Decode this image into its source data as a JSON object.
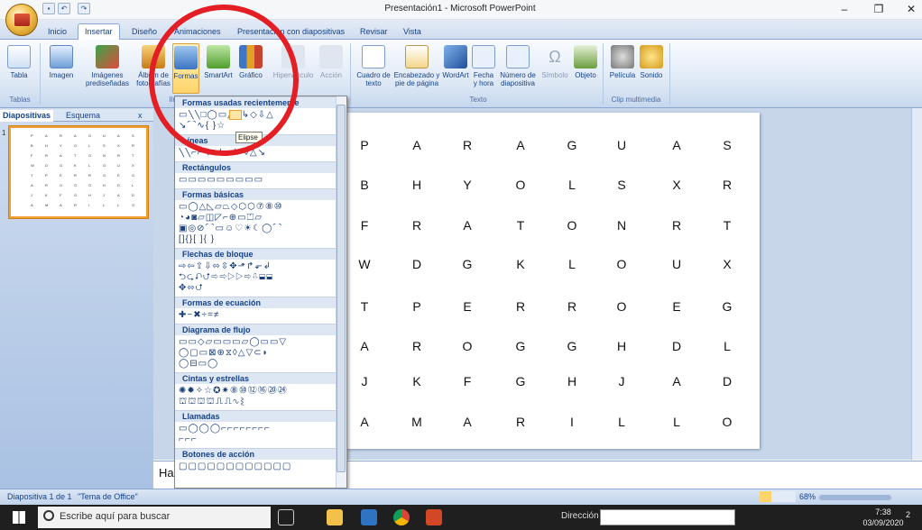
{
  "window": {
    "title": "Presentación1 - Microsoft PowerPoint"
  },
  "tabs": [
    "Inicio",
    "Insertar",
    "Diseño",
    "Animaciones",
    "Presentación con diapositivas",
    "Revisar",
    "Vista"
  ],
  "ribbon": {
    "groups": [
      "Tablas",
      "Ilustraciones",
      "Texto",
      "Clip multimedia"
    ],
    "buttons": {
      "tabla": "Tabla",
      "imagen": "Imagen",
      "imagenes_pre": "Imágenes prediseñadas",
      "album": "Álbum de fotografías",
      "formas": "Formas",
      "smartart": "SmartArt",
      "grafico": "Gráfico",
      "hipervinculo": "Hipervínculo",
      "accion": "Acción",
      "cuadro_texto": "Cuadro de texto",
      "encabezado": "Encabezado y pie de página",
      "wordart": "WordArt",
      "fecha": "Fecha y hora",
      "numero": "Número de diapositiva",
      "simbolo": "Símbolo",
      "objeto": "Objeto",
      "pelicula": "Película",
      "sonido": "Sonido"
    }
  },
  "left_pane": {
    "tab1": "Diapositivas",
    "tab2": "Esquema",
    "close": "x",
    "slide_number": "1"
  },
  "shapes_menu": {
    "sections": [
      "Formas usadas recientemente",
      "Líneas",
      "Rectángulos",
      "Formas básicas",
      "Flechas de bloque",
      "Formas de ecuación",
      "Diagrama de flujo",
      "Cintas y estrellas",
      "Llamadas",
      "Botones de acción"
    ],
    "tooltip": "Elipse"
  },
  "slide": {
    "rows": [
      [
        "P",
        "A",
        "R",
        "A",
        "G",
        "U",
        "A",
        "S"
      ],
      [
        "B",
        "H",
        "Y",
        "O",
        "L",
        "S",
        "X",
        "R"
      ],
      [
        "F",
        "R",
        "A",
        "T",
        "O",
        "N",
        "R",
        "T"
      ],
      [
        "W",
        "D",
        "G",
        "K",
        "L",
        "O",
        "U",
        "X"
      ],
      [
        "T",
        "P",
        "E",
        "R",
        "R",
        "O",
        "E",
        "G"
      ],
      [
        "A",
        "R",
        "O",
        "G",
        "G",
        "H",
        "D",
        "L"
      ],
      [
        "J",
        "K",
        "F",
        "G",
        "H",
        "J",
        "A",
        "D"
      ],
      [
        "A",
        "M",
        "A",
        "R",
        "I",
        "L",
        "L",
        "O"
      ]
    ]
  },
  "notes": {
    "text": "Ha"
  },
  "status": {
    "slide": "Diapositiva 1 de 1",
    "theme": "\"Tema de Office\"",
    "zoom": "68%"
  },
  "taskbar": {
    "search_placeholder": "Escribe aquí para buscar",
    "address_label": "Dirección",
    "time": "7:38",
    "date": "03/09/2020",
    "notif": "2"
  }
}
